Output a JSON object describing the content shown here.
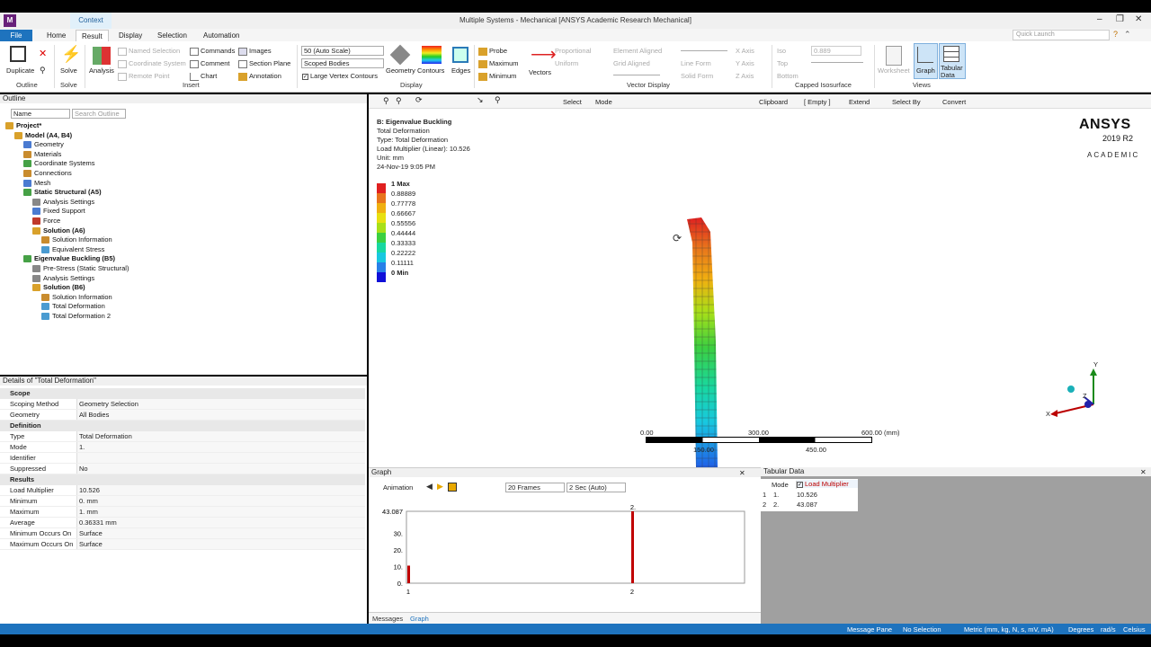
{
  "window": {
    "title": "Multiple Systems - Mechanical [ANSYS Academic Research Mechanical]",
    "context_tab": "Context",
    "app_icon_label": "M"
  },
  "tabs": [
    "File",
    "Home",
    "Result",
    "Display",
    "Selection",
    "Automation"
  ],
  "active_tab": "Result",
  "quick_launch_placeholder": "Quick Launch",
  "ribbon": {
    "outline_group": {
      "duplicate": "Duplicate",
      "label": "Outline"
    },
    "solve_group": {
      "solve": "Solve",
      "label": "Solve"
    },
    "analysis": "Analysis",
    "insert": {
      "named_selection": "Named Selection",
      "coordinate_system": "Coordinate System",
      "remote_point": "Remote Point",
      "commands": "Commands",
      "comment": "Comment",
      "chart": "Chart",
      "images": "Images",
      "section_plane": "Section Plane",
      "annotation": "Annotation",
      "label": "Insert"
    },
    "display": {
      "scale": "50 (Auto Scale)",
      "scope": "Scoped Bodies",
      "large_vertex_contours": "Large Vertex Contours",
      "geometry": "Geometry",
      "contours": "Contours",
      "edges": "Edges",
      "label": "Display"
    },
    "probe_group": {
      "probe": "Probe",
      "maximum": "Maximum",
      "minimum": "Minimum"
    },
    "vectors": "Vectors",
    "vector_display": {
      "proportional": "Proportional",
      "uniform": "Uniform",
      "element_aligned": "Element Aligned",
      "grid_aligned": "Grid Aligned",
      "line_form": "Line Form",
      "solid_form": "Solid Form",
      "x_axis": "X Axis",
      "y_axis": "Y Axis",
      "z_axis": "Z Axis",
      "label": "Vector Display"
    },
    "capped": {
      "iso": "Iso",
      "top": "Top",
      "bottom": "Bottom",
      "value": "0.889",
      "label": "Capped Isosurface"
    },
    "views": {
      "worksheet": "Worksheet",
      "graph": "Graph",
      "tabular": "Tabular Data",
      "label": "Views"
    }
  },
  "outline": {
    "title": "Outline",
    "filter": "Name",
    "search_placeholder": "Search Outline",
    "tree": [
      {
        "label": "Project*",
        "bold": true,
        "level": 0,
        "color": "#d9a12b"
      },
      {
        "label": "Model (A4, B4)",
        "bold": true,
        "level": 1,
        "color": "#d9a12b"
      },
      {
        "label": "Geometry",
        "bold": false,
        "level": 2,
        "color": "#4a7bd1"
      },
      {
        "label": "Materials",
        "bold": false,
        "level": 2,
        "color": "#c98c2e"
      },
      {
        "label": "Coordinate Systems",
        "bold": false,
        "level": 2,
        "color": "#46a146"
      },
      {
        "label": "Connections",
        "bold": false,
        "level": 2,
        "color": "#c98c2e"
      },
      {
        "label": "Mesh",
        "bold": false,
        "level": 2,
        "color": "#4a7bd1"
      },
      {
        "label": "Static Structural (A5)",
        "bold": true,
        "level": 2,
        "color": "#46a146"
      },
      {
        "label": "Analysis Settings",
        "bold": false,
        "level": 3,
        "color": "#888888"
      },
      {
        "label": "Fixed Support",
        "bold": false,
        "level": 3,
        "color": "#4a7bd1"
      },
      {
        "label": "Force",
        "bold": false,
        "level": 3,
        "color": "#c0392b"
      },
      {
        "label": "Solution (A6)",
        "bold": true,
        "level": 3,
        "color": "#d9a12b"
      },
      {
        "label": "Solution Information",
        "bold": false,
        "level": 4,
        "color": "#c98c2e"
      },
      {
        "label": "Equivalent Stress",
        "bold": false,
        "level": 4,
        "color": "#4a9bd1"
      },
      {
        "label": "Eigenvalue Buckling (B5)",
        "bold": true,
        "level": 2,
        "color": "#46a146"
      },
      {
        "label": "Pre-Stress (Static Structural)",
        "bold": false,
        "level": 3,
        "color": "#888888"
      },
      {
        "label": "Analysis Settings",
        "bold": false,
        "level": 3,
        "color": "#888888"
      },
      {
        "label": "Solution (B6)",
        "bold": true,
        "level": 3,
        "color": "#d9a12b"
      },
      {
        "label": "Solution Information",
        "bold": false,
        "level": 4,
        "color": "#c98c2e"
      },
      {
        "label": "Total Deformation",
        "bold": false,
        "level": 4,
        "color": "#4a9bd1"
      },
      {
        "label": "Total Deformation 2",
        "bold": false,
        "level": 4,
        "color": "#4a9bd1"
      }
    ]
  },
  "details": {
    "title": "Details of \"Total Deformation\"",
    "sections": [
      {
        "name": "Scope",
        "rows": [
          [
            "Scoping Method",
            "Geometry Selection"
          ],
          [
            "Geometry",
            "All Bodies"
          ]
        ]
      },
      {
        "name": "Definition",
        "rows": [
          [
            "Type",
            "Total Deformation"
          ],
          [
            "Mode",
            "1."
          ],
          [
            "Identifier",
            ""
          ],
          [
            "Suppressed",
            "No"
          ]
        ]
      },
      {
        "name": "Results",
        "rows": [
          [
            "Load Multiplier",
            "10.526"
          ],
          [
            "Minimum",
            "0. mm"
          ],
          [
            "Maximum",
            "1. mm"
          ],
          [
            "Average",
            "0.36331 mm"
          ],
          [
            "Minimum Occurs On",
            "Surface"
          ],
          [
            "Maximum Occurs On",
            "Surface"
          ]
        ]
      }
    ]
  },
  "viewport_toolbar": {
    "select": "Select",
    "mode": "Mode",
    "clipboard": "Clipboard",
    "empty": "[ Empty ]",
    "extend": "Extend",
    "select_by": "Select By",
    "convert": "Convert"
  },
  "result_info": [
    "B: Eigenvalue Buckling",
    "Total Deformation",
    "Type: Total Deformation",
    "Load Multiplier (Linear): 10.526",
    "Unit: mm",
    "24-Nov-19 9:05 PM"
  ],
  "legend": [
    {
      "label": "1 Max",
      "color": "#e02020",
      "bold": true
    },
    {
      "label": "0.88889",
      "color": "#e8741c"
    },
    {
      "label": "0.77778",
      "color": "#f0b010"
    },
    {
      "label": "0.66667",
      "color": "#e8e010"
    },
    {
      "label": "0.55556",
      "color": "#a8e018"
    },
    {
      "label": "0.44444",
      "color": "#3cd040"
    },
    {
      "label": "0.33333",
      "color": "#18d8a0"
    },
    {
      "label": "0.22222",
      "color": "#18c8e0"
    },
    {
      "label": "0.11111",
      "color": "#2880e8"
    },
    {
      "label": "0 Min",
      "color": "#1010d8",
      "bold": true
    }
  ],
  "scale_bar": {
    "ticks": [
      "0.00",
      "300.00",
      "600.00 (mm)"
    ],
    "sub_ticks": [
      "150.00",
      "450.00"
    ]
  },
  "logo": {
    "brand": "ANSYS",
    "version": "2019 R2",
    "edition": "ACADEMIC"
  },
  "triad": {
    "x": "X",
    "y": "Y",
    "z": "Z"
  },
  "graph_panel": {
    "title": "Graph",
    "animation": "Animation",
    "frames": "20 Frames",
    "duration": "2 Sec (Auto)",
    "bottom_tabs": [
      "Messages",
      "Graph"
    ],
    "active_bottom_tab": "Graph"
  },
  "tabular_panel": {
    "title": "Tabular Data",
    "headers": [
      "Mode",
      "Load Multiplier"
    ],
    "rows": [
      [
        "1",
        "1.",
        "10.526"
      ],
      [
        "2",
        "2.",
        "43.087"
      ]
    ]
  },
  "chart_data": {
    "type": "bar",
    "categories": [
      "1",
      "2"
    ],
    "values": [
      10.526,
      43.087
    ],
    "ylim": [
      0,
      43.087
    ],
    "yticks": [
      "43.087",
      "30.",
      "20.",
      "10.",
      "0."
    ],
    "bar_labels": [
      "",
      "2."
    ],
    "color": "#c00000"
  },
  "status_bar": {
    "message_pane": "Message Pane",
    "selection": "No Selection",
    "units": "Metric (mm, kg, N, s, mV, mA)",
    "angle": "Degrees",
    "rot": "rad/s",
    "temp": "Celsius"
  }
}
